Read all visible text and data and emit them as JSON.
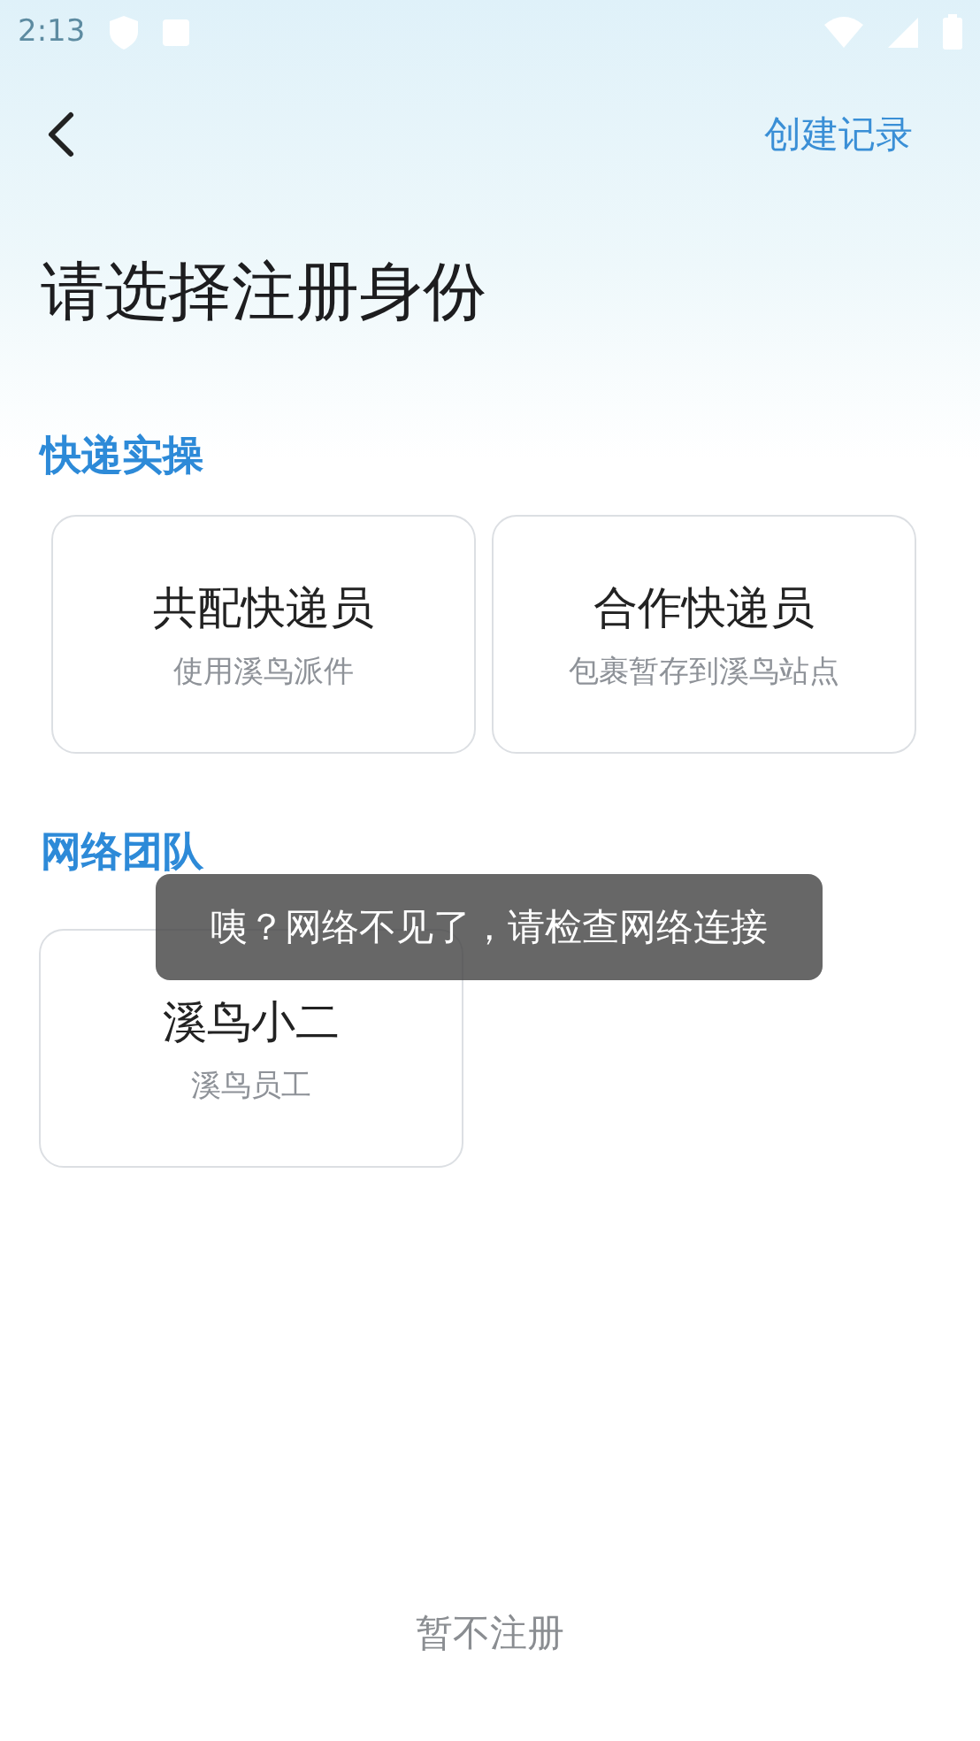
{
  "status_bar": {
    "time": "2:13"
  },
  "header": {
    "action": "创建记录"
  },
  "title": "请选择注册身份",
  "sections": [
    {
      "heading": "快递实操",
      "cards": [
        {
          "title": "共配快递员",
          "subtitle": "使用溪鸟派件"
        },
        {
          "title": "合作快递员",
          "subtitle": "包裹暂存到溪鸟站点"
        }
      ]
    },
    {
      "heading": "网络团队",
      "cards": [
        {
          "title": "溪鸟小二",
          "subtitle": "溪鸟员工"
        }
      ]
    }
  ],
  "toast": "咦？网络不见了，请检查网络连接",
  "skip_button": "暂不注册"
}
